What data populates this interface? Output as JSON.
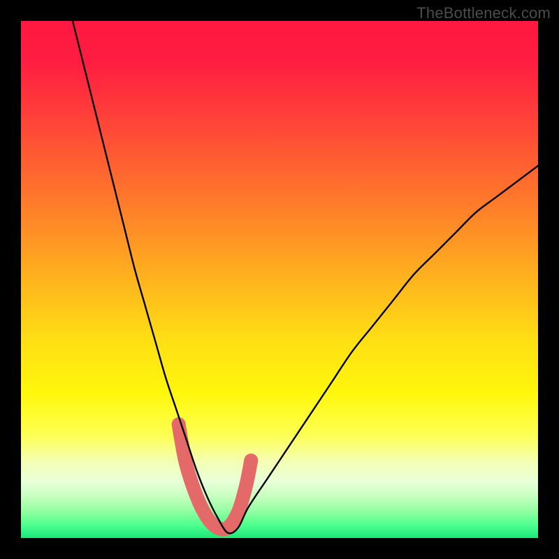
{
  "watermark": "TheBottleneck.com",
  "chart_data": {
    "type": "line",
    "title": "",
    "xlabel": "",
    "ylabel": "",
    "xlim": [
      0,
      100
    ],
    "ylim": [
      0,
      100
    ],
    "series": [
      {
        "name": "bottleneck-curve",
        "x": [
          10,
          12,
          14,
          16,
          18,
          20,
          22,
          24,
          26,
          28,
          30,
          32,
          34,
          36,
          38,
          40,
          42,
          44,
          48,
          52,
          56,
          60,
          64,
          68,
          72,
          76,
          80,
          84,
          88,
          92,
          96,
          100
        ],
        "y": [
          100,
          92,
          84,
          76,
          68,
          60,
          52,
          45,
          38,
          31,
          25,
          19,
          13,
          8,
          4,
          1,
          2,
          6,
          12,
          18,
          24,
          30,
          36,
          41,
          46,
          51,
          55,
          59,
          63,
          66,
          69,
          72
        ]
      }
    ],
    "marker_points": {
      "x": [
        30.5,
        31,
        32,
        34,
        36,
        38,
        40,
        42,
        43.5,
        44.5
      ],
      "y": [
        22,
        19,
        14,
        8,
        4,
        2,
        2,
        5,
        10,
        15
      ]
    },
    "gradient": {
      "stops": [
        {
          "pos": 0.0,
          "color": "#ff173f"
        },
        {
          "pos": 0.08,
          "color": "#ff1d41"
        },
        {
          "pos": 0.2,
          "color": "#ff4538"
        },
        {
          "pos": 0.35,
          "color": "#ff7a2b"
        },
        {
          "pos": 0.5,
          "color": "#ffb31e"
        },
        {
          "pos": 0.62,
          "color": "#ffe014"
        },
        {
          "pos": 0.72,
          "color": "#fff70c"
        },
        {
          "pos": 0.8,
          "color": "#fdff52"
        },
        {
          "pos": 0.85,
          "color": "#f4ffb0"
        },
        {
          "pos": 0.89,
          "color": "#e8ffd8"
        },
        {
          "pos": 0.92,
          "color": "#c7ffbf"
        },
        {
          "pos": 0.95,
          "color": "#8fffa0"
        },
        {
          "pos": 0.975,
          "color": "#4dff8e"
        },
        {
          "pos": 1.0,
          "color": "#19e87a"
        }
      ]
    },
    "curve_color": "#000000",
    "marker_color": "#e46a6a"
  }
}
